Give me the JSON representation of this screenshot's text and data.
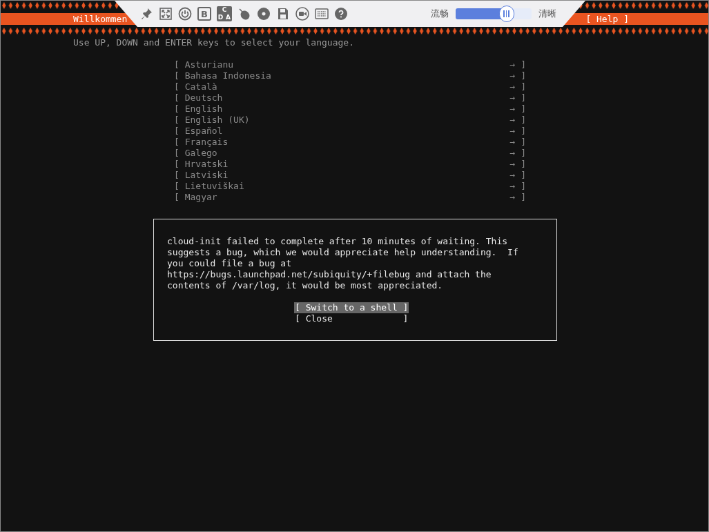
{
  "header": {
    "title": "Willkommen",
    "help": "[ Help ]"
  },
  "toolbar": {
    "icons": [
      {
        "kind": "pin"
      },
      {
        "kind": "fullscreen"
      },
      {
        "kind": "power"
      },
      {
        "kind": "boot",
        "letter": "B"
      },
      {
        "kind": "keys",
        "letters": [
          "C",
          "D",
          "A"
        ]
      },
      {
        "kind": "mouse"
      },
      {
        "kind": "disc"
      },
      {
        "kind": "floppy"
      },
      {
        "kind": "camera"
      },
      {
        "kind": "keyboard"
      },
      {
        "kind": "help"
      }
    ],
    "slider": {
      "left_label": "流畅",
      "right_label": "清晰",
      "level": 0.67
    }
  },
  "instruction": "Use UP, DOWN and ENTER keys to select your language.",
  "languages": [
    {
      "open": "[",
      "name": "Asturianu",
      "arrow": "→",
      "close": "]"
    },
    {
      "open": "[",
      "name": "Bahasa Indonesia",
      "arrow": "→",
      "close": "]"
    },
    {
      "open": "[",
      "name": "Català",
      "arrow": "→",
      "close": "]"
    },
    {
      "open": "[",
      "name": "Deutsch",
      "arrow": "→",
      "close": "]"
    },
    {
      "open": "[",
      "name": "English",
      "arrow": "→",
      "close": "]"
    },
    {
      "open": "[",
      "name": "English (UK)",
      "arrow": "→",
      "close": "]"
    },
    {
      "open": "[",
      "name": "Español",
      "arrow": "→",
      "close": "]"
    },
    {
      "open": "[",
      "name": "Français",
      "arrow": "→",
      "close": "]"
    },
    {
      "open": "[",
      "name": "Galego",
      "arrow": "→",
      "close": "]"
    },
    {
      "open": "[",
      "name": "Hrvatski",
      "arrow": "→",
      "close": "]"
    },
    {
      "open": "[",
      "name": "Latviski",
      "arrow": "→",
      "close": "]"
    },
    {
      "open": "[",
      "name": "Lietuviškai",
      "arrow": "→",
      "close": "]"
    },
    {
      "open": "[",
      "name": "Magyar",
      "arrow": "→",
      "close": "]"
    }
  ],
  "dialog": {
    "message": "cloud-init failed to complete after 10 minutes of waiting. This\nsuggests a bug, which we would appreciate help understanding.  If\nyou could file a bug at\nhttps://bugs.launchpad.net/subiquity/+filebug and attach the\ncontents of /var/log, it would be most appreciated.",
    "buttons": [
      {
        "label": "[ Switch to a shell ]",
        "selected": true
      },
      {
        "label": "[ Close             ]",
        "selected": false
      }
    ]
  }
}
